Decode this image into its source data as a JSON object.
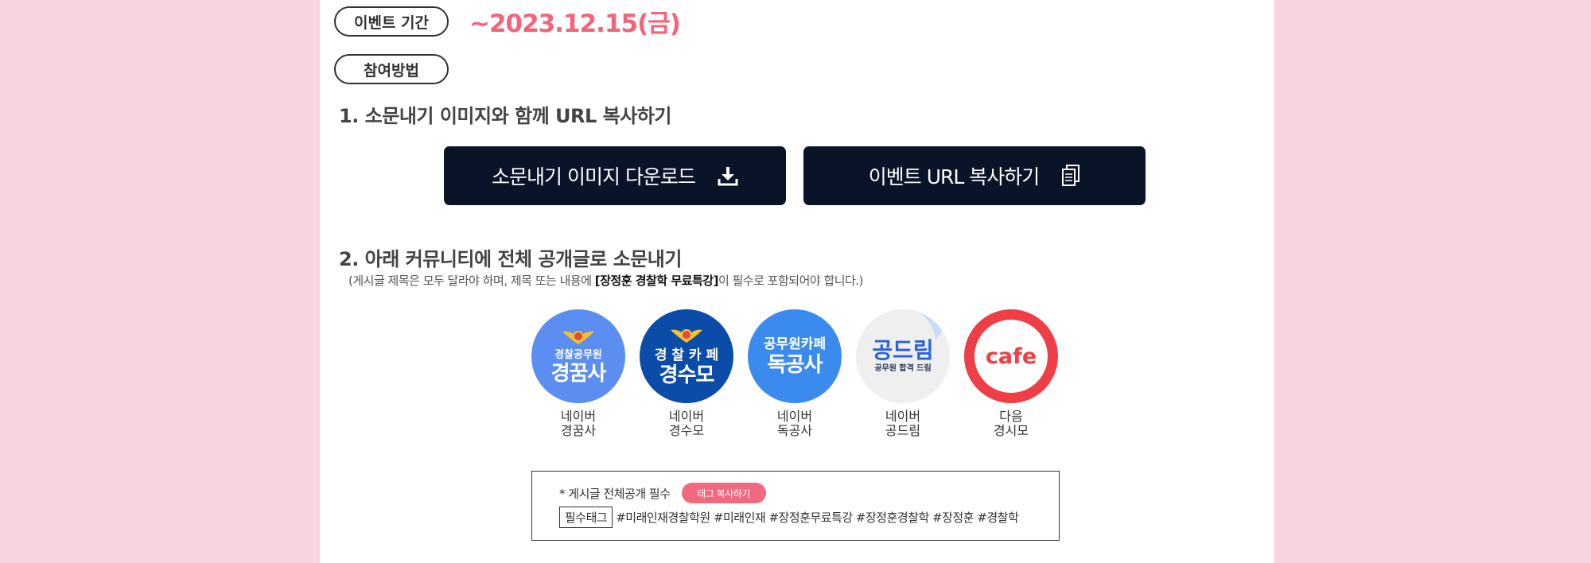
{
  "event_period": {
    "label": "이벤트 기간",
    "value": "~2023.12.15(금)"
  },
  "participation": {
    "label": "참여방법"
  },
  "step1": {
    "title": "1. 소문내기 이미지와 함께 URL 복사하기",
    "download_button": {
      "label": "소문내기 이미지 다운로드",
      "icon": "download-icon"
    },
    "copy_url_button": {
      "label": "이벤트 URL 복사하기",
      "icon": "copy-icon"
    }
  },
  "step2": {
    "title": "2. 아래 커뮤니티에 전체 공개글로 소문내기",
    "note_before": "(게시글 제목은 모두 달라야 하며, 제목 또는 내용에 ",
    "note_bold": "[장정훈 경찰학 무료특강]",
    "note_after": "이 필수로 포함되어야 합니다.)"
  },
  "communities": [
    {
      "logo_line1": "경찰공무원",
      "logo_line2": "경꿈사",
      "name_line1": "네이버",
      "name_line2": "경꿈사",
      "color": "#5b8ef0"
    },
    {
      "logo_line1": "경 찰 카 페",
      "logo_line2": "경수모",
      "name_line1": "네이버",
      "name_line2": "경수모",
      "color": "#0b4ca8"
    },
    {
      "logo_line1": "공무원카페",
      "logo_line2": "독공사",
      "name_line1": "네이버",
      "name_line2": "독공사",
      "color": "#3b8bef"
    },
    {
      "logo_line1": "공드림",
      "logo_line2": "공무원 합격 드림",
      "name_line1": "네이버",
      "name_line2": "공드림",
      "color": "#efefef"
    },
    {
      "logo_line1": "cafe",
      "name_line1": "다음",
      "name_line2": "경시모",
      "color": "#ef3f46"
    }
  ],
  "tag_box": {
    "required_text": "* 게시글 전체공개 필수",
    "copy_button": "태그 복사하기",
    "required_label": "필수태그",
    "tags": "#미래인재경찰학원 #미래인재 #장정훈무료특강  #장정훈경찰학 #장정훈 #경찰학"
  },
  "colors": {
    "background": "#f9d3e2",
    "accent": "#f46478",
    "button_dark": "#0a1428",
    "tag_button": "#ef6a7e"
  }
}
